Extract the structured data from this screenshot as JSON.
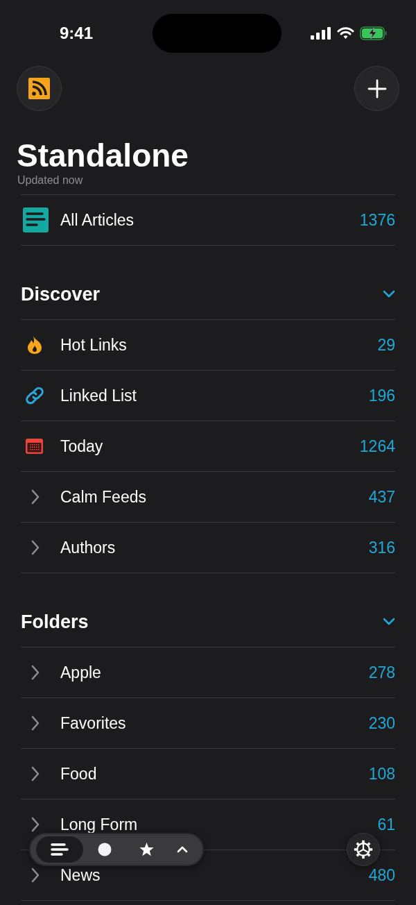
{
  "status_bar": {
    "time": "9:41"
  },
  "title": "Standalone",
  "subtitle": "Updated now",
  "all_articles": {
    "label": "All Articles",
    "count": "1376"
  },
  "sections": [
    {
      "title": "Discover",
      "expanded": true,
      "items": [
        {
          "kind": "flame",
          "label": "Hot Links",
          "count": "29"
        },
        {
          "kind": "link",
          "label": "Linked List",
          "count": "196"
        },
        {
          "kind": "calendar",
          "label": "Today",
          "count": "1264"
        },
        {
          "kind": "group",
          "label": "Calm Feeds",
          "count": "437"
        },
        {
          "kind": "group",
          "label": "Authors",
          "count": "316"
        }
      ]
    },
    {
      "title": "Folders",
      "expanded": true,
      "items": [
        {
          "kind": "group",
          "label": "Apple",
          "count": "278"
        },
        {
          "kind": "group",
          "label": "Favorites",
          "count": "230"
        },
        {
          "kind": "group",
          "label": "Food",
          "count": "108"
        },
        {
          "kind": "group",
          "label": "Long Form",
          "count": "61"
        },
        {
          "kind": "group",
          "label": "News",
          "count": "480"
        }
      ]
    }
  ],
  "filters": [
    {
      "kind": "all",
      "selected": true
    },
    {
      "kind": "unread",
      "selected": false
    },
    {
      "kind": "starred",
      "selected": false
    },
    {
      "kind": "more",
      "selected": false
    }
  ]
}
